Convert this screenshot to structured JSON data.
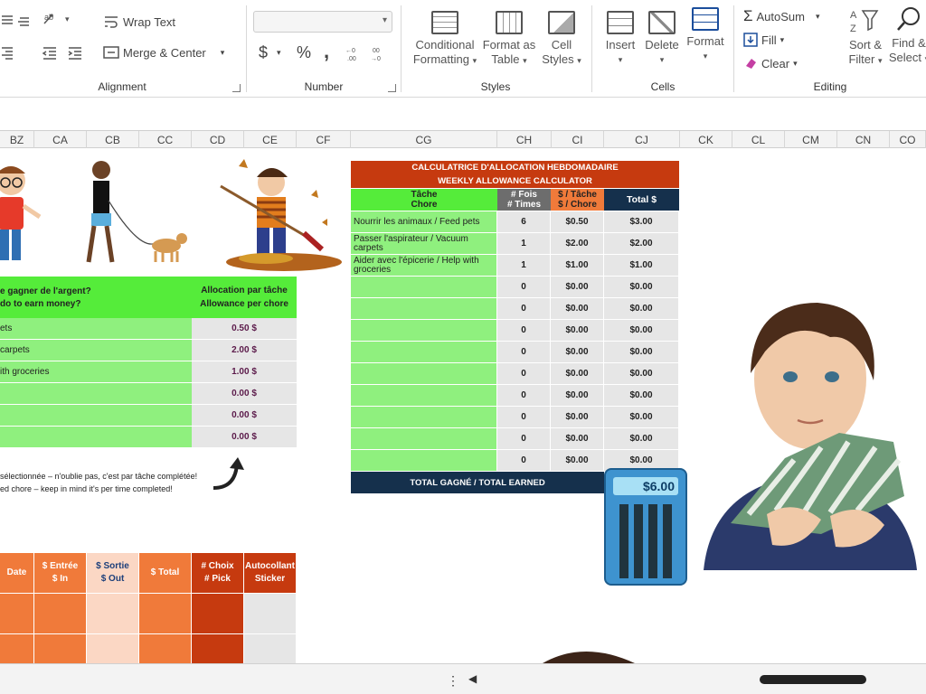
{
  "ribbon": {
    "alignment": {
      "wrap_text": "Wrap Text",
      "merge_center": "Merge & Center",
      "label": "Alignment"
    },
    "number": {
      "format_value": "",
      "currency": "$",
      "percent": "%",
      "comma": ",",
      "label": "Number"
    },
    "styles": {
      "conditional": "Conditional",
      "formatting": "Formatting",
      "format_as": "Format as",
      "table": "Table",
      "cell": "Cell",
      "styles_word": "Styles",
      "label": "Styles"
    },
    "cells": {
      "insert": "Insert",
      "delete": "Delete",
      "format": "Format",
      "label": "Cells"
    },
    "editing": {
      "autosum": "AutoSum",
      "fill": "Fill",
      "clear": "Clear",
      "sort": "Sort &",
      "filter": "Filter",
      "find": "Find &",
      "select": "Select",
      "label": "Editing"
    }
  },
  "columns": [
    "BZ",
    "CA",
    "CB",
    "CC",
    "CD",
    "CE",
    "CF",
    "CG",
    "CH",
    "CI",
    "CJ",
    "CK",
    "CL",
    "CM",
    "CN",
    "CO"
  ],
  "left_table": {
    "header_left_1": "e gagner de l'argent?",
    "header_left_2": "do to earn money?",
    "header_right_1": "Allocation par tâche",
    "header_right_2": "Allowance per chore",
    "rows": [
      {
        "chore": "ets",
        "amount": "0.50 $"
      },
      {
        "chore": "carpets",
        "amount": "2.00 $"
      },
      {
        "chore": "ith groceries",
        "amount": "1.00 $"
      },
      {
        "chore": "",
        "amount": "0.00 $"
      },
      {
        "chore": "",
        "amount": "0.00 $"
      },
      {
        "chore": "",
        "amount": "0.00 $"
      }
    ],
    "note_1": "sélectionnée – n'oublie pas, c'est par tâche complétée!",
    "note_2": "ed chore – keep in mind it's per time completed!"
  },
  "calculator": {
    "title_1": "CALCULATRICE D'ALLOCATION HEBDOMADAIRE",
    "title_2": "WEEKLY ALLOWANCE CALCULATOR",
    "h_chore_1": "Tâche",
    "h_chore_2": "Chore",
    "h_times_1": "# Fois",
    "h_times_2": "# Times",
    "h_per_1": "$ / Tâche",
    "h_per_2": "$ / Chore",
    "h_total": "Total $",
    "rows": [
      {
        "chore": "Nourrir les animaux / Feed pets",
        "times": "6",
        "per": "$0.50",
        "total": "$3.00"
      },
      {
        "chore": "Passer l'aspirateur / Vacuum carpets",
        "times": "1",
        "per": "$2.00",
        "total": "$2.00"
      },
      {
        "chore": "Aider avec l'épicerie / Help with groceries",
        "times": "1",
        "per": "$1.00",
        "total": "$1.00"
      },
      {
        "chore": "",
        "times": "0",
        "per": "$0.00",
        "total": "$0.00"
      },
      {
        "chore": "",
        "times": "0",
        "per": "$0.00",
        "total": "$0.00"
      },
      {
        "chore": "",
        "times": "0",
        "per": "$0.00",
        "total": "$0.00"
      },
      {
        "chore": "",
        "times": "0",
        "per": "$0.00",
        "total": "$0.00"
      },
      {
        "chore": "",
        "times": "0",
        "per": "$0.00",
        "total": "$0.00"
      },
      {
        "chore": "",
        "times": "0",
        "per": "$0.00",
        "total": "$0.00"
      },
      {
        "chore": "",
        "times": "0",
        "per": "$0.00",
        "total": "$0.00"
      },
      {
        "chore": "",
        "times": "0",
        "per": "$0.00",
        "total": "$0.00"
      },
      {
        "chore": "",
        "times": "0",
        "per": "$0.00",
        "total": "$0.00"
      }
    ],
    "total_label": "TOTAL GAGNÉ / TOTAL EARNED",
    "display": "$6.00"
  },
  "ledger": {
    "headers": [
      {
        "l1": "Date",
        "l2": ""
      },
      {
        "l1": "$ Entrée",
        "l2": "$ In"
      },
      {
        "l1": "$ Sortie",
        "l2": "$ Out"
      },
      {
        "l1": "$ Total",
        "l2": ""
      },
      {
        "l1": "# Choix",
        "l2": "# Pick"
      },
      {
        "l1": "Autocollant",
        "l2": "Sticker"
      }
    ]
  },
  "colors": {
    "green_header": "#55ec3a",
    "green_row": "#8ff07e",
    "title_red": "#c63a0f",
    "navy": "#15304c",
    "orange": "#f07a3a"
  }
}
